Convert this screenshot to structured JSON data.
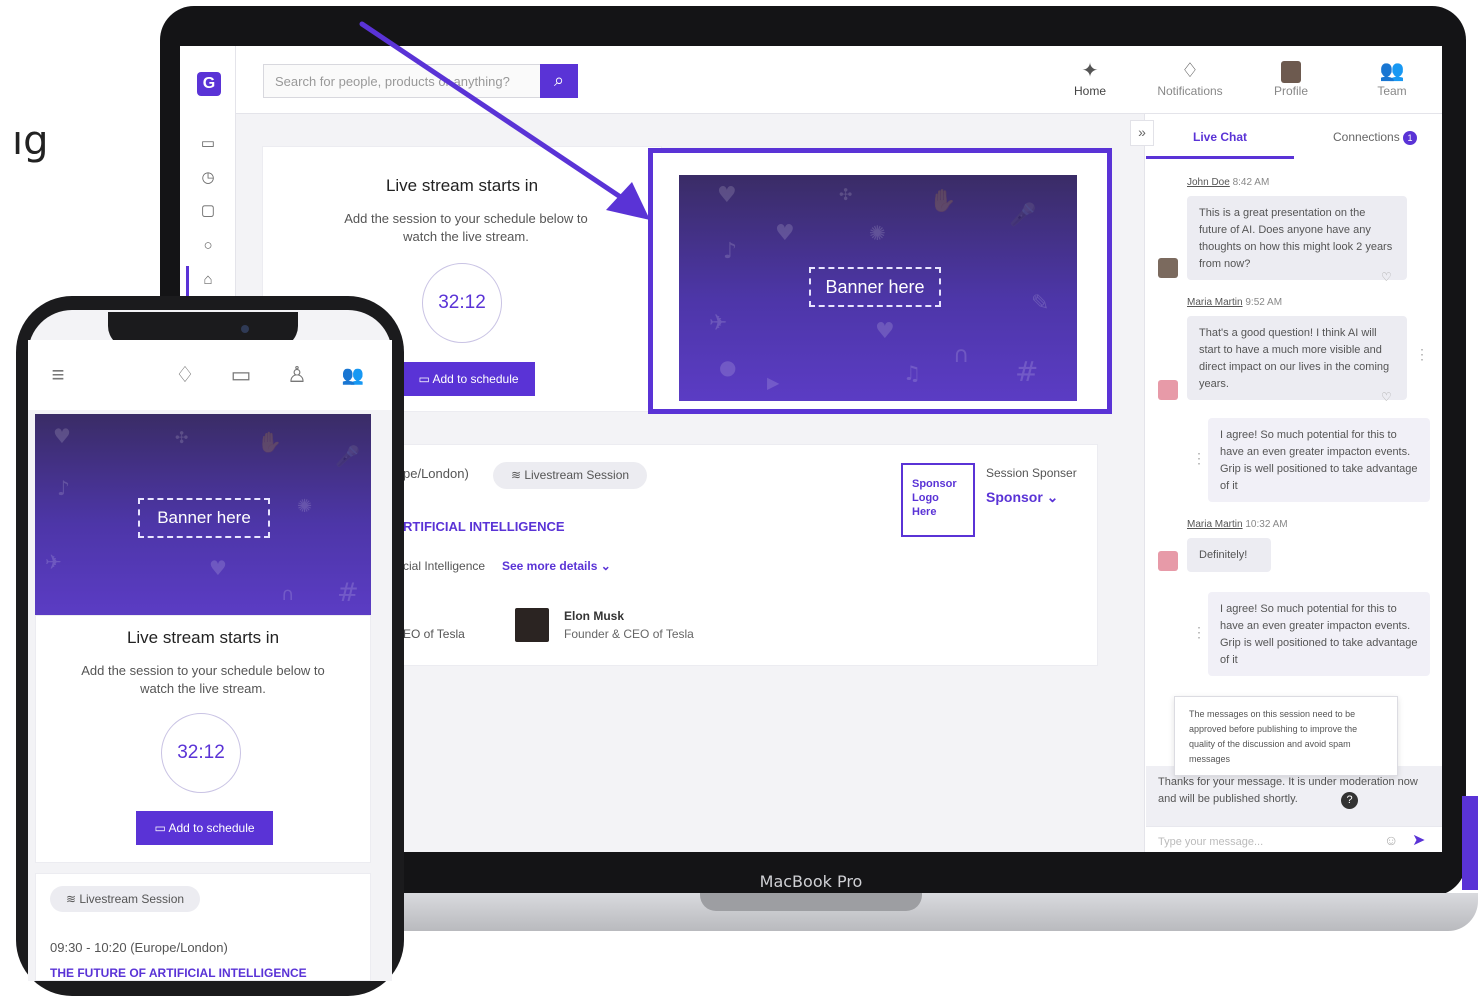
{
  "page": {
    "cut_text": "ıg"
  },
  "laptop": {
    "label": "MacBook Pro",
    "logo": "G",
    "rail_icons": [
      "calendar-icon",
      "calendar-clock-icon",
      "chat-alert-icon",
      "clock-icon",
      "building-icon"
    ],
    "search": {
      "placeholder": "Search for people, products or anything?"
    },
    "nav": [
      {
        "label": "Home",
        "icon": "handshake-icon"
      },
      {
        "label": "Notifications",
        "icon": "bell-icon"
      },
      {
        "label": "Profile",
        "icon": "avatar"
      },
      {
        "label": "Team",
        "icon": "team-icon"
      }
    ],
    "live": {
      "title": "Live stream starts in",
      "subtitle": "Add the session to your schedule below to watch the live stream.",
      "timer": "32:12",
      "add_button": "Add to schedule"
    },
    "banner": {
      "label": "Banner here"
    },
    "session": {
      "timezone_fragment": "pe/London)",
      "chip": "Livestream Session",
      "title_fragment": "RTIFICIAL INTELLIGENCE",
      "topic_fragment": "cial Intelligence",
      "see_more": "See more details",
      "speaker1_role_fragment": "EO of Tesla",
      "speaker2_name": "Elon Musk",
      "speaker2_role": "Founder & CEO of Tesla",
      "sponsor_logo": "Sponsor Logo Here",
      "sponsor_label": "Session Sponser",
      "sponsor_name": "Sponsor"
    },
    "chat": {
      "tab_live": "Live Chat",
      "tab_connections": "Connections",
      "connections_badge": "1",
      "messages": [
        {
          "author": "John Doe",
          "time": "8:42 AM",
          "text": "This is a great presentation on the future of AI. Does anyone have any thoughts on how this might look 2 years from now?"
        },
        {
          "author": "Maria Martin",
          "time": "9:52 AM",
          "text": "That's a good question! I think AI will start to have a much more visible and direct impact on our lives in the coming years."
        },
        {
          "text": "I agree! So much potential for this to have an even greater impacton events. Grip is well positioned to take advantage of it"
        },
        {
          "author": "Maria Martin",
          "time": "10:32 AM",
          "text": "Definitely!"
        },
        {
          "text": "I agree! So much potential for this to have an even greater impacton events. Grip is well positioned to take advantage of it"
        }
      ],
      "moderation_tooltip": "The messages on this session need to be approved before publishing to improve the quality of the discussion and avoid spam messages",
      "moderation_notice": "Thanks for your message. It is under moderation now and will be published shortly.",
      "input_placeholder": "Type your message..."
    }
  },
  "phone": {
    "banner_label": "Banner here",
    "live_title": "Live stream starts in",
    "live_subtitle": "Add the session to your schedule below to watch the live stream.",
    "timer": "32:12",
    "add_button": "Add to schedule",
    "chip": "Livestream Session",
    "time": "09:30 - 10:20 (Europe/London)",
    "session_title": "THE FUTURE OF ARTIFICIAL INTELLIGENCE"
  },
  "colors": {
    "accent": "#5a33d6",
    "banner_dark": "#3a2c66",
    "banner_light": "#5b3cc4"
  }
}
